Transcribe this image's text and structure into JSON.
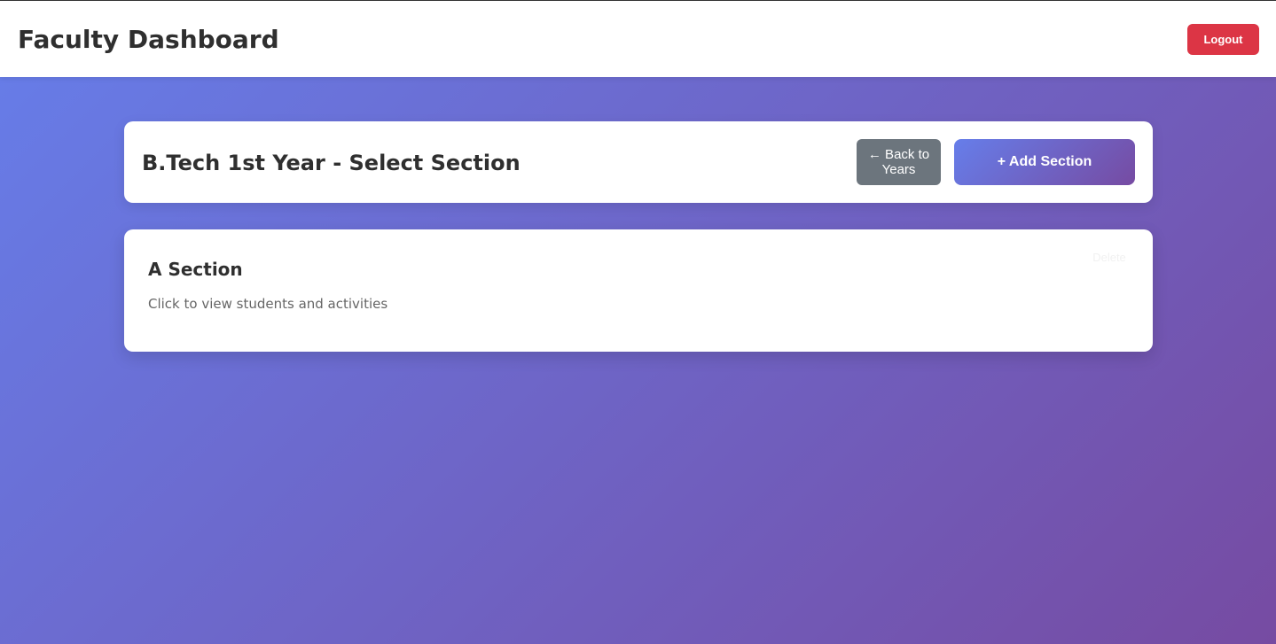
{
  "navbar": {
    "title": "Faculty Dashboard",
    "logout_label": "Logout"
  },
  "header": {
    "title": "B.Tech 1st Year - Select Section",
    "back_label": "← Back to Years",
    "add_label": "+ Add Section"
  },
  "sections": [
    {
      "name": "A Section",
      "description": "Click to view students and activities",
      "delete_label": "Delete"
    }
  ],
  "colors": {
    "gradient_start": "#667eea",
    "gradient_end": "#764ba2",
    "logout": "#dc3545",
    "back": "#6c757d"
  }
}
